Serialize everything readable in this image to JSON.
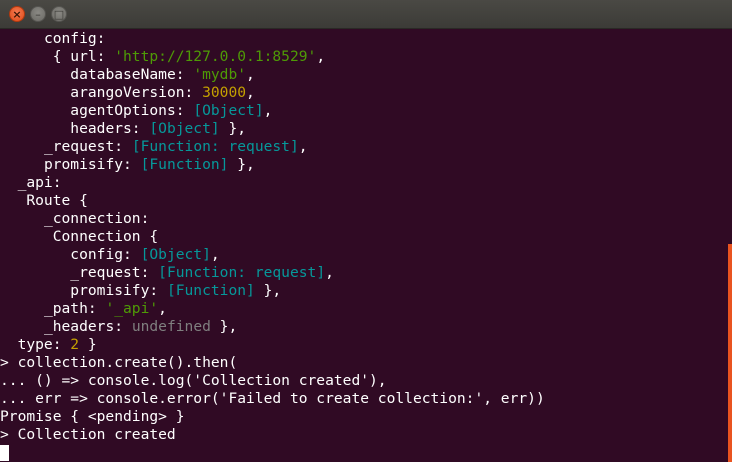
{
  "window": {
    "close": "×",
    "minimize": "–",
    "maximize": "□"
  },
  "lines": [
    [
      [
        "config:",
        ""
      ]
    ],
    [
      [
        "{ url: ",
        ""
      ],
      [
        "'http://127.0.0.1:8529'",
        "str"
      ],
      [
        ",",
        ""
      ]
    ],
    [
      [
        "databaseName: ",
        ""
      ],
      [
        "'mydb'",
        "str"
      ],
      [
        ",",
        ""
      ]
    ],
    [
      [
        "arangoVersion: ",
        ""
      ],
      [
        "30000",
        "num"
      ],
      [
        ",",
        ""
      ]
    ],
    [
      [
        "agentOptions: ",
        ""
      ],
      [
        "[Object]",
        "special"
      ],
      [
        ",",
        ""
      ]
    ],
    [
      [
        "headers: ",
        ""
      ],
      [
        "[Object]",
        "special"
      ],
      [
        " },",
        ""
      ]
    ],
    [
      [
        "_request: ",
        ""
      ],
      [
        "[Function: request]",
        "special"
      ],
      [
        ",",
        ""
      ]
    ],
    [
      [
        "promisify: ",
        ""
      ],
      [
        "[Function]",
        "special"
      ],
      [
        " },",
        ""
      ]
    ],
    [
      [
        "_api:",
        ""
      ]
    ],
    [
      [
        "Route {",
        ""
      ]
    ],
    [
      [
        "_connection:",
        ""
      ]
    ],
    [
      [
        "Connection {",
        ""
      ]
    ],
    [
      [
        "config: ",
        ""
      ],
      [
        "[Object]",
        "special"
      ],
      [
        ",",
        ""
      ]
    ],
    [
      [
        "_request: ",
        ""
      ],
      [
        "[Function: request]",
        "special"
      ],
      [
        ",",
        ""
      ]
    ],
    [
      [
        "promisify: ",
        ""
      ],
      [
        "[Function]",
        "special"
      ],
      [
        " },",
        ""
      ]
    ],
    [
      [
        "_path: ",
        ""
      ],
      [
        "'_api'",
        "str"
      ],
      [
        ",",
        ""
      ]
    ],
    [
      [
        "_headers: ",
        ""
      ],
      [
        "undefined",
        "undef"
      ],
      [
        " },",
        ""
      ]
    ],
    [
      [
        "type: ",
        ""
      ],
      [
        "2",
        "num"
      ],
      [
        " }",
        ""
      ]
    ],
    [
      [
        "> collection.create().then(",
        ""
      ]
    ],
    [
      [
        "... () => console.log('Collection created'),",
        ""
      ]
    ],
    [
      [
        "... err => console.error('Failed to create collection:', err))",
        ""
      ]
    ],
    [
      [
        "Promise { <pending> }",
        ""
      ]
    ],
    [
      [
        "> Collection created",
        ""
      ]
    ],
    []
  ]
}
